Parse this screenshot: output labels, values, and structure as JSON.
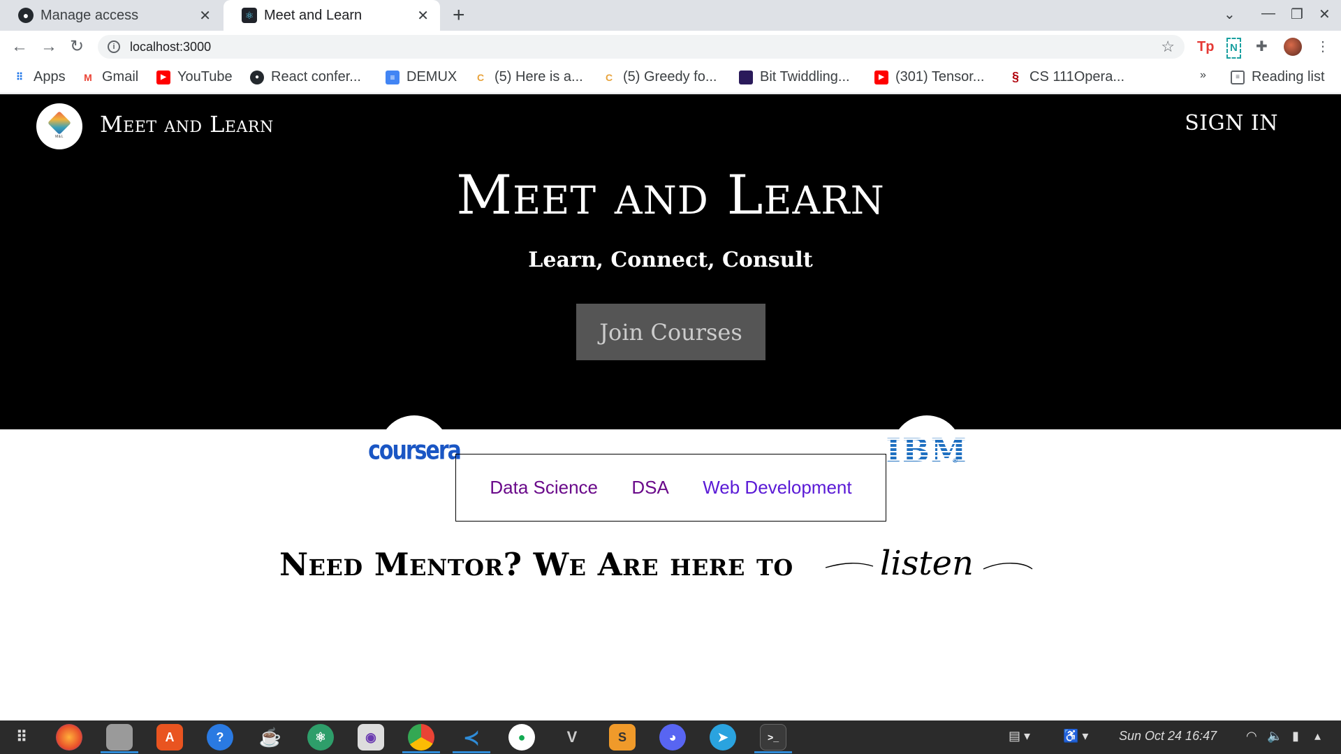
{
  "browser": {
    "tabs": [
      {
        "title": "Manage access",
        "icon": "github-icon"
      },
      {
        "title": "Meet and Learn",
        "icon": "react-icon"
      }
    ],
    "url": "localhost:3000",
    "bookmarks": [
      {
        "label": "Apps",
        "icon": "apps-grid-icon"
      },
      {
        "label": "Gmail",
        "icon": "gmail-icon"
      },
      {
        "label": "YouTube",
        "icon": "youtube-icon"
      },
      {
        "label": "React confer...",
        "icon": "github-icon"
      },
      {
        "label": "DEMUX",
        "icon": "docs-icon"
      },
      {
        "label": "(5) Here is a...",
        "icon": "codechef-icon"
      },
      {
        "label": "(5) Greedy fo...",
        "icon": "codechef-icon"
      },
      {
        "label": "Bit Twiddling...",
        "icon": "bookmark-icon"
      },
      {
        "label": "(301) Tensor...",
        "icon": "youtube-icon"
      },
      {
        "label": "CS 111Opera...",
        "icon": "stanford-icon"
      }
    ],
    "reading_list": "Reading list"
  },
  "site": {
    "brand": "Meet and Learn",
    "sign_in": "SIGN IN",
    "hero_title": "Meet and Learn",
    "hero_subtitle": "Learn, Connect, Consult",
    "join_button": "Join Courses",
    "partners": [
      {
        "name": "coursera",
        "label": "coursera"
      },
      {
        "name": "ibm",
        "label": "IBM"
      }
    ],
    "topics": [
      "Data Science",
      "DSA",
      "Web Development"
    ],
    "mentor_heading": "Need Mentor? We Are here to",
    "mentor_script": "listen"
  },
  "taskbar": {
    "clock": "Sun Oct 24  16:47",
    "apps": [
      "app-grid-icon",
      "firefox-icon",
      "files-icon",
      "software-store-icon",
      "help-icon",
      "jupyter-icon",
      "atom-icon",
      "screenshot-icon",
      "chrome-icon",
      "vscode-icon",
      "mongodb-compass-icon",
      "vim-icon",
      "sublime-text-icon",
      "discord-icon",
      "telegram-icon",
      "terminal-icon"
    ]
  },
  "colors": {
    "hero_bg": "#000000",
    "join_button_bg": "#555555",
    "link_visited": "#6a0a8a",
    "link": "#5a1ad6",
    "taskbar_bg": "#2b2b2b"
  }
}
